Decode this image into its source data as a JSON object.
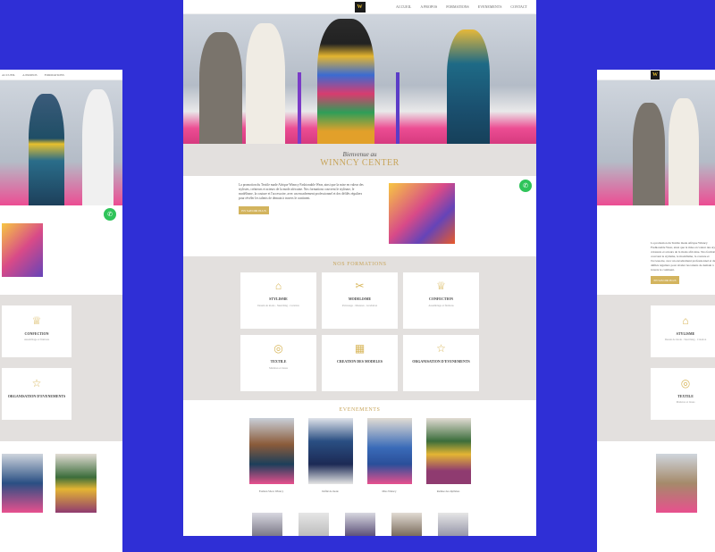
{
  "site": {
    "logo_text": "W",
    "nav": [
      "ACCUEIL",
      "A PROPOS",
      "FORMATIONS",
      "EVENEMENTS",
      "CONTACT"
    ],
    "welcome_subtitle": "Bienvenue au",
    "welcome_title": "WINNCY CENTER",
    "about_text": "La promotion du Textile made Afrique Winncy Fashionable Wear, ainsi que la mise en valeur des stylistes, créateurs et acteurs de la mode africaine. Nos formations couvrent le stylisme, le modélisme, la couture et l'accessoire, avec un encadrement professionnel et des défilés réguliers pour révéler les talents de demain à travers le continent.",
    "about_button": "EN SAVOIR PLUS",
    "whatsapp_icon": "whatsapp-icon",
    "formations_title": "NOS FORMATIONS",
    "formations": [
      {
        "icon": "graduation-cap-icon",
        "glyph": "⌂",
        "title": "STYLISME",
        "desc": "Dessin de mode - Sketching - Création"
      },
      {
        "icon": "scissors-icon",
        "glyph": "✂",
        "title": "MODELISME",
        "desc": "Patronage - Mesures - Gradation"
      },
      {
        "icon": "dress-icon",
        "glyph": "♕",
        "title": "CONFECTION",
        "desc": "Assemblage et finitions"
      },
      {
        "icon": "textile-icon",
        "glyph": "◎",
        "title": "TEXTILE",
        "desc": "Matières et tissus"
      },
      {
        "icon": "pattern-icon",
        "glyph": "▦",
        "title": "CREATION DES MODELES",
        "desc": ""
      },
      {
        "icon": "star-icon",
        "glyph": "☆",
        "title": "ORGANISATION D'EVENEMENTS",
        "desc": ""
      }
    ],
    "events_title": "EVENEMENTS",
    "events": [
      {
        "caption": "Fashion Show Winncy"
      },
      {
        "caption": "Défilé de mode"
      },
      {
        "caption": "Miss Winncy"
      },
      {
        "caption": "Remise des diplômes"
      }
    ]
  },
  "colors": {
    "background": "#2f2fd6",
    "gold": "#c7a45a",
    "panel_grey": "#e3e0de",
    "accent_pink": "#ec4d93",
    "whatsapp_green": "#2fc45a"
  }
}
